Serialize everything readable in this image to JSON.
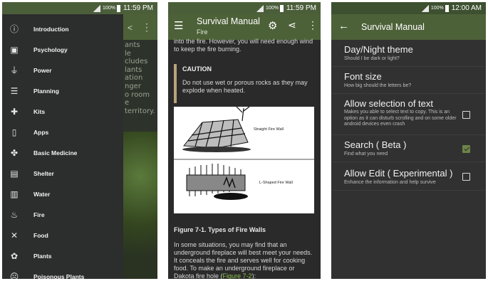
{
  "status": {
    "battery": "100%",
    "time1": "11:59 PM",
    "time2": "11:59 PM",
    "time3": "12:00 AM"
  },
  "screen1": {
    "behind_text": "ants\nle\ncludes\nlants\nation\nnger\no room\ne\nterritory.",
    "nav": [
      {
        "label": "Introduction",
        "icon": "info-icon"
      },
      {
        "label": "Psychology",
        "icon": "portrait-icon"
      },
      {
        "label": "Power",
        "icon": "plug-icon"
      },
      {
        "label": "Planning",
        "icon": "list-icon"
      },
      {
        "label": "Kits",
        "icon": "medical-bag-icon"
      },
      {
        "label": "Apps",
        "icon": "phone-icon"
      },
      {
        "label": "Basic Medicine",
        "icon": "bandage-icon"
      },
      {
        "label": "Shelter",
        "icon": "shelter-icon"
      },
      {
        "label": "Water",
        "icon": "water-icon"
      },
      {
        "label": "Fire",
        "icon": "flame-icon"
      },
      {
        "label": "Food",
        "icon": "utensils-icon"
      },
      {
        "label": "Plants",
        "icon": "flower-icon"
      },
      {
        "label": "Poisonous Plants",
        "icon": "sad-face-icon"
      }
    ]
  },
  "screen2": {
    "title": "Survival Manual",
    "subtitle": "Fire",
    "para1": "into the fire. However, you will need enough wind to keep the fire burning.",
    "caution_heading": "CAUTION",
    "caution_text": "Do not use wet or porous rocks as they may explode when heated.",
    "figure_label_1": "Straight Fire Wall",
    "figure_label_2": "L-Shaped Fire Wall",
    "figure_caption": "Figure 7-1. Types of Fire Walls",
    "para2": "In some situations, you may find that an underground fireplace will best meet your needs. It conceals the fire and serves well for cooking food. To make an underground fireplace or Dakota fire hole (",
    "para2_link": "Figure 7-2",
    "para2_end": "):"
  },
  "screen3": {
    "title": "Survival Manual",
    "settings": [
      {
        "heading": "Day/Night theme",
        "desc": "Should I be dark or light?"
      },
      {
        "heading": "Font size",
        "desc": "How big should the letters be?"
      },
      {
        "heading": "Allow selection of text",
        "desc": "Makes you able to select text to copy. This is an option as it can disturb scrolling and on some older android devices even crash",
        "checked": false
      },
      {
        "heading": "Search ( Beta )",
        "desc": "Find what you need",
        "checked": true
      },
      {
        "heading": "Allow Edit ( Experimental )",
        "desc": "Enhance the information and help survive",
        "checked": false
      }
    ]
  },
  "colors": {
    "appbar": "#4d6138",
    "statusbar": "#4b5e3a",
    "accent": "#8bc34a"
  }
}
